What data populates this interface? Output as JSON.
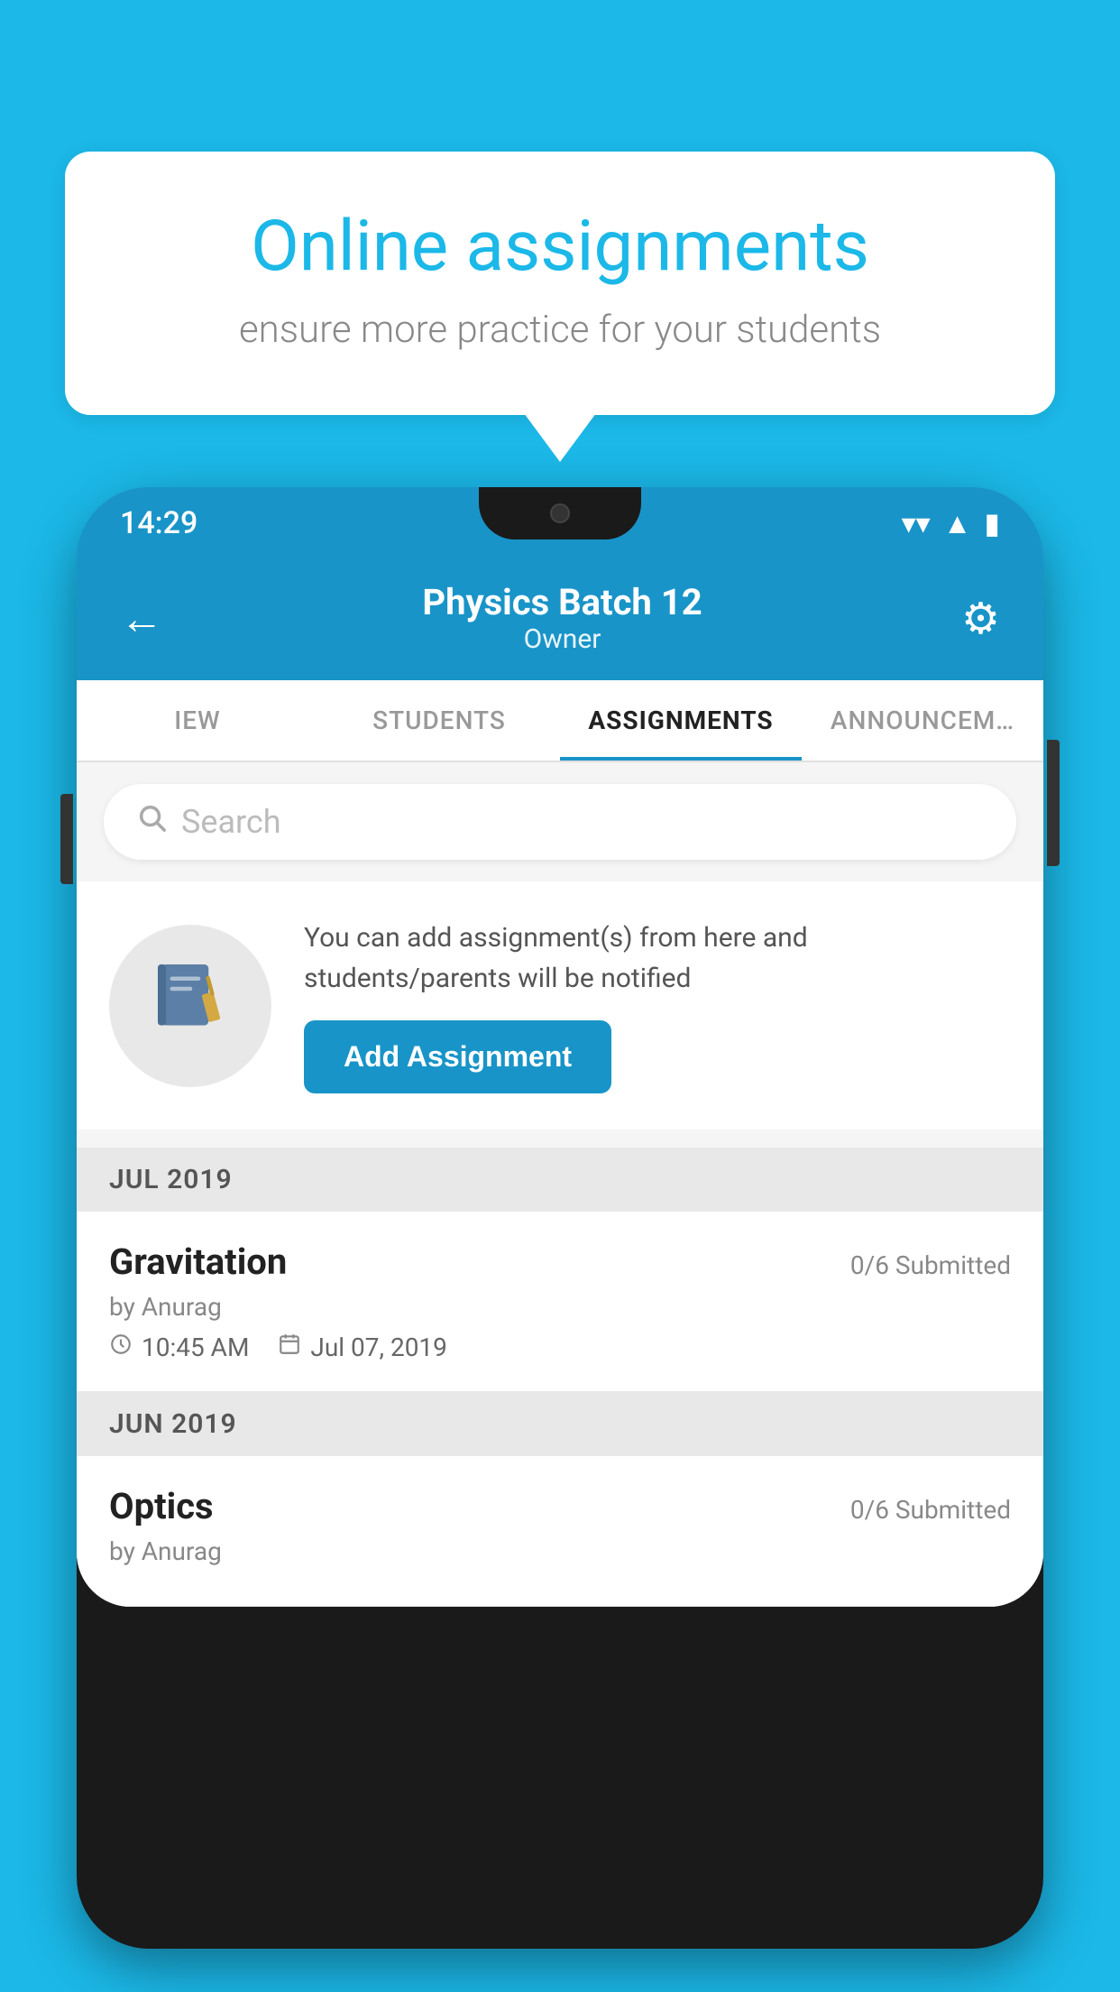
{
  "background_color": "#1bb8e8",
  "speech_bubble": {
    "title": "Online assignments",
    "subtitle": "ensure more practice for your students"
  },
  "phone": {
    "status_bar": {
      "time": "14:29"
    },
    "header": {
      "title": "Physics Batch 12",
      "subtitle": "Owner",
      "back_label": "←",
      "settings_label": "⚙"
    },
    "tabs": [
      {
        "label": "IEW",
        "active": false
      },
      {
        "label": "STUDENTS",
        "active": false
      },
      {
        "label": "ASSIGNMENTS",
        "active": true
      },
      {
        "label": "ANNOUNCEM…",
        "active": false
      }
    ],
    "search": {
      "placeholder": "Search"
    },
    "promo": {
      "description": "You can add assignment(s) from here and students/parents will be notified",
      "button_label": "Add Assignment"
    },
    "sections": [
      {
        "label": "JUL 2019",
        "assignments": [
          {
            "name": "Gravitation",
            "submitted": "0/6 Submitted",
            "by": "by Anurag",
            "time": "10:45 AM",
            "date": "Jul 07, 2019"
          }
        ]
      },
      {
        "label": "JUN 2019",
        "assignments": [
          {
            "name": "Optics",
            "submitted": "0/6 Submitted",
            "by": "by Anurag",
            "time": "",
            "date": ""
          }
        ]
      }
    ]
  }
}
